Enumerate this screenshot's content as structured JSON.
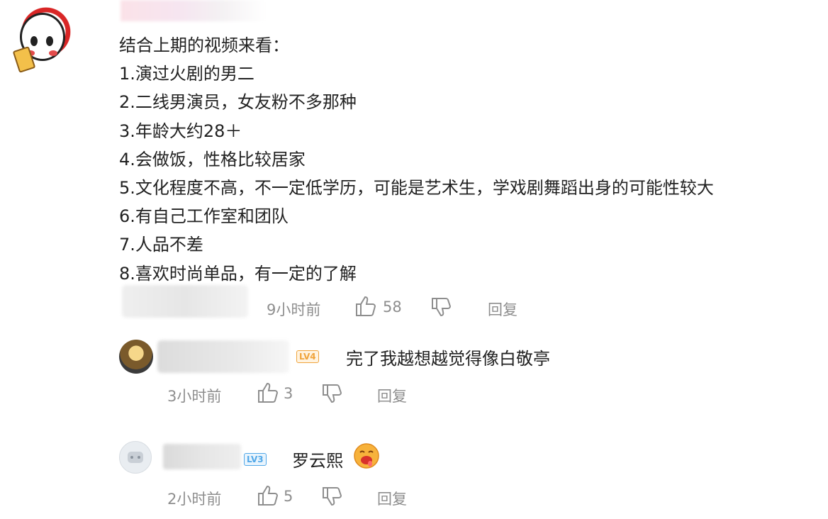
{
  "main_comment": {
    "lines": [
      "结合上期的视频来看：",
      "1.演过火剧的男二",
      "2.二线男演员，女友粉不多那种",
      "3.年龄大约28＋",
      "4.会做饭，性格比较居家",
      "5.文化程度不高，不一定低学历，可能是艺术生，学戏剧舞蹈出身的可能性较大",
      "6.有自己工作室和团队",
      "7.人品不差",
      "8.喜欢时尚单品，有一定的了解"
    ],
    "time": "9小时前",
    "likes": "58",
    "reply_label": "回复",
    "avatar_icon": "cartoon-face-avatar"
  },
  "replies": [
    {
      "level": "LV4",
      "level_color": "#f0a43c",
      "text": "完了我越想越觉得像白敬亭",
      "time": "3小时前",
      "likes": "3",
      "reply_label": "回复",
      "avatar_icon": "anime-boy-avatar"
    },
    {
      "level": "LV3",
      "level_color": "#52a8e8",
      "text": "罗云熙",
      "time": "2小时前",
      "likes": "5",
      "reply_label": "回复",
      "avatar_icon": "robot-default-avatar",
      "emoji_icon": "drooling-emoji"
    }
  ],
  "colors": {
    "text": "#222222",
    "meta": "#8e8e8e"
  }
}
